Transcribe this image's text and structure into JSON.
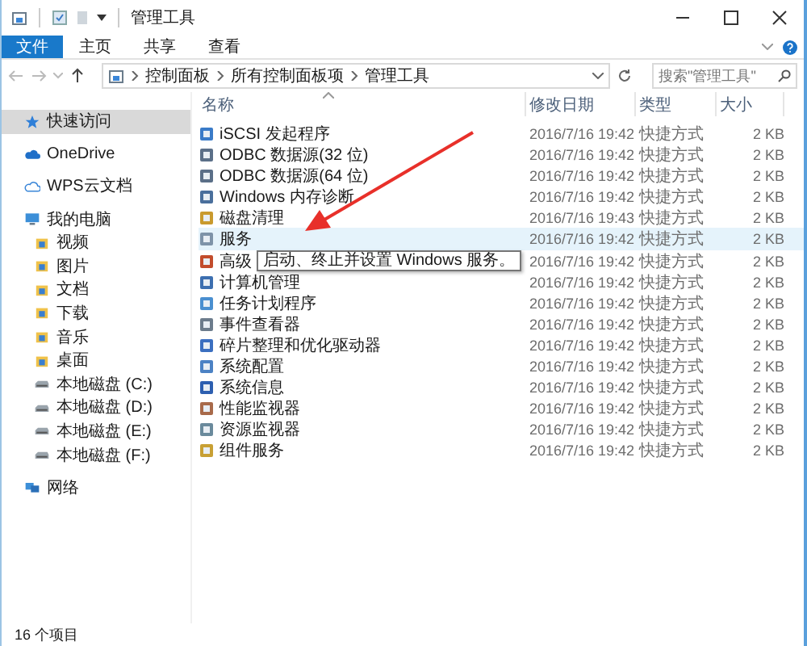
{
  "window": {
    "title": "管理工具"
  },
  "ribbon": {
    "file_tab": "文件",
    "tabs": [
      {
        "label": "主页",
        "selected": false
      },
      {
        "label": "共享",
        "selected": false
      },
      {
        "label": "查看",
        "selected": false
      }
    ]
  },
  "address": {
    "path": [
      "控制面板",
      "所有控制面板项",
      "管理工具"
    ],
    "search_placeholder": "搜索\"管理工具\""
  },
  "sidebar": {
    "items": [
      {
        "label": "快速访问",
        "kind": "star",
        "selected": true
      },
      {
        "label": "OneDrive",
        "kind": "cloud",
        "selected": false
      },
      {
        "label": "WPS云文档",
        "kind": "cloud-outline",
        "selected": false
      },
      {
        "label": "我的电脑",
        "kind": "pc",
        "selected": false,
        "children": [
          {
            "label": "视频",
            "kind": "folder",
            "selected": false
          },
          {
            "label": "图片",
            "kind": "folder",
            "selected": false
          },
          {
            "label": "文档",
            "kind": "folder",
            "selected": false
          },
          {
            "label": "下载",
            "kind": "folder",
            "selected": false
          },
          {
            "label": "音乐",
            "kind": "folder",
            "selected": false
          },
          {
            "label": "桌面",
            "kind": "folder",
            "selected": false
          },
          {
            "label": "本地磁盘 (C:)",
            "kind": "drive",
            "selected": false
          },
          {
            "label": "本地磁盘 (D:)",
            "kind": "drive",
            "selected": false
          },
          {
            "label": "本地磁盘 (E:)",
            "kind": "drive",
            "selected": false
          },
          {
            "label": "本地磁盘 (F:)",
            "kind": "drive",
            "selected": false
          }
        ]
      },
      {
        "label": "网络",
        "kind": "network",
        "selected": false
      }
    ]
  },
  "table": {
    "columns": [
      "名称",
      "修改日期",
      "类型",
      "大小"
    ],
    "rows": [
      {
        "name": "iSCSI 发起程序",
        "modified": "2016/7/16 19:42",
        "type": "快捷方式",
        "size": "2 KB",
        "hovered": false
      },
      {
        "name": "ODBC 数据源(32 位)",
        "modified": "2016/7/16 19:42",
        "type": "快捷方式",
        "size": "2 KB",
        "hovered": false
      },
      {
        "name": "ODBC 数据源(64 位)",
        "modified": "2016/7/16 19:42",
        "type": "快捷方式",
        "size": "2 KB",
        "hovered": false
      },
      {
        "name": "Windows 内存诊断",
        "modified": "2016/7/16 19:42",
        "type": "快捷方式",
        "size": "2 KB",
        "hovered": false
      },
      {
        "name": "磁盘清理",
        "modified": "2016/7/16 19:43",
        "type": "快捷方式",
        "size": "2 KB",
        "hovered": false
      },
      {
        "name": "服务",
        "modified": "2016/7/16 19:42",
        "type": "快捷方式",
        "size": "2 KB",
        "hovered": true
      },
      {
        "name": "高级",
        "modified": "2016/7/16 19:42",
        "type": "快捷方式",
        "size": "2 KB",
        "hovered": false
      },
      {
        "name": "计算机管理",
        "modified": "2016/7/16 19:42",
        "type": "快捷方式",
        "size": "2 KB",
        "hovered": false
      },
      {
        "name": "任务计划程序",
        "modified": "2016/7/16 19:42",
        "type": "快捷方式",
        "size": "2 KB",
        "hovered": false
      },
      {
        "name": "事件查看器",
        "modified": "2016/7/16 19:42",
        "type": "快捷方式",
        "size": "2 KB",
        "hovered": false
      },
      {
        "name": "碎片整理和优化驱动器",
        "modified": "2016/7/16 19:42",
        "type": "快捷方式",
        "size": "2 KB",
        "hovered": false
      },
      {
        "name": "系统配置",
        "modified": "2016/7/16 19:42",
        "type": "快捷方式",
        "size": "2 KB",
        "hovered": false
      },
      {
        "name": "系统信息",
        "modified": "2016/7/16 19:42",
        "type": "快捷方式",
        "size": "2 KB",
        "hovered": false
      },
      {
        "name": "性能监视器",
        "modified": "2016/7/16 19:42",
        "type": "快捷方式",
        "size": "2 KB",
        "hovered": false
      },
      {
        "name": "资源监视器",
        "modified": "2016/7/16 19:42",
        "type": "快捷方式",
        "size": "2 KB",
        "hovered": false
      },
      {
        "name": "组件服务",
        "modified": "2016/7/16 19:42",
        "type": "快捷方式",
        "size": "2 KB",
        "hovered": false
      }
    ]
  },
  "tooltip": {
    "text": "启动、终止并设置 Windows 服务。"
  },
  "status_bar": {
    "text": "16 个项目"
  }
}
